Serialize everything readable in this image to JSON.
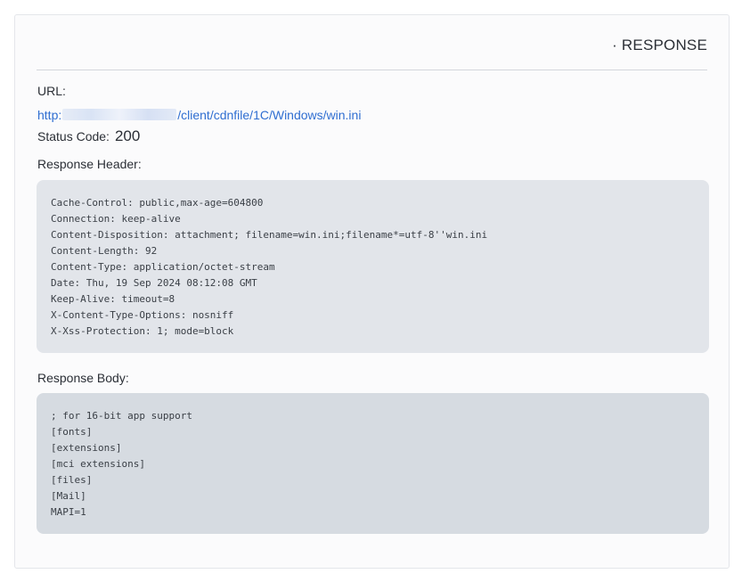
{
  "panel": {
    "title": "· RESPONSE"
  },
  "url": {
    "label": "URL:",
    "prefix": "http:",
    "suffix": "/client/cdnfile/1C/Windows/win.ini"
  },
  "status": {
    "label": "Status Code:",
    "value": "200"
  },
  "response_header": {
    "label": "Response Header:",
    "lines": [
      "Cache-Control: public,max-age=604800",
      "Connection: keep-alive",
      "Content-Disposition: attachment; filename=win.ini;filename*=utf-8''win.ini",
      "Content-Length: 92",
      "Content-Type: application/octet-stream",
      "Date: Thu, 19 Sep 2024 08:12:08 GMT",
      "Keep-Alive: timeout=8",
      "X-Content-Type-Options: nosniff",
      "X-Xss-Protection: 1; mode=block"
    ]
  },
  "response_body": {
    "label": "Response Body:",
    "lines": [
      "; for 16-bit app support",
      "[fonts]",
      "[extensions]",
      "[mci extensions]",
      "[files]",
      "[Mail]",
      "MAPI=1"
    ]
  },
  "colors": {
    "link": "#2f6ed1",
    "header_box_bg": "#e2e5ea",
    "body_box_bg": "#d6dbe1"
  }
}
